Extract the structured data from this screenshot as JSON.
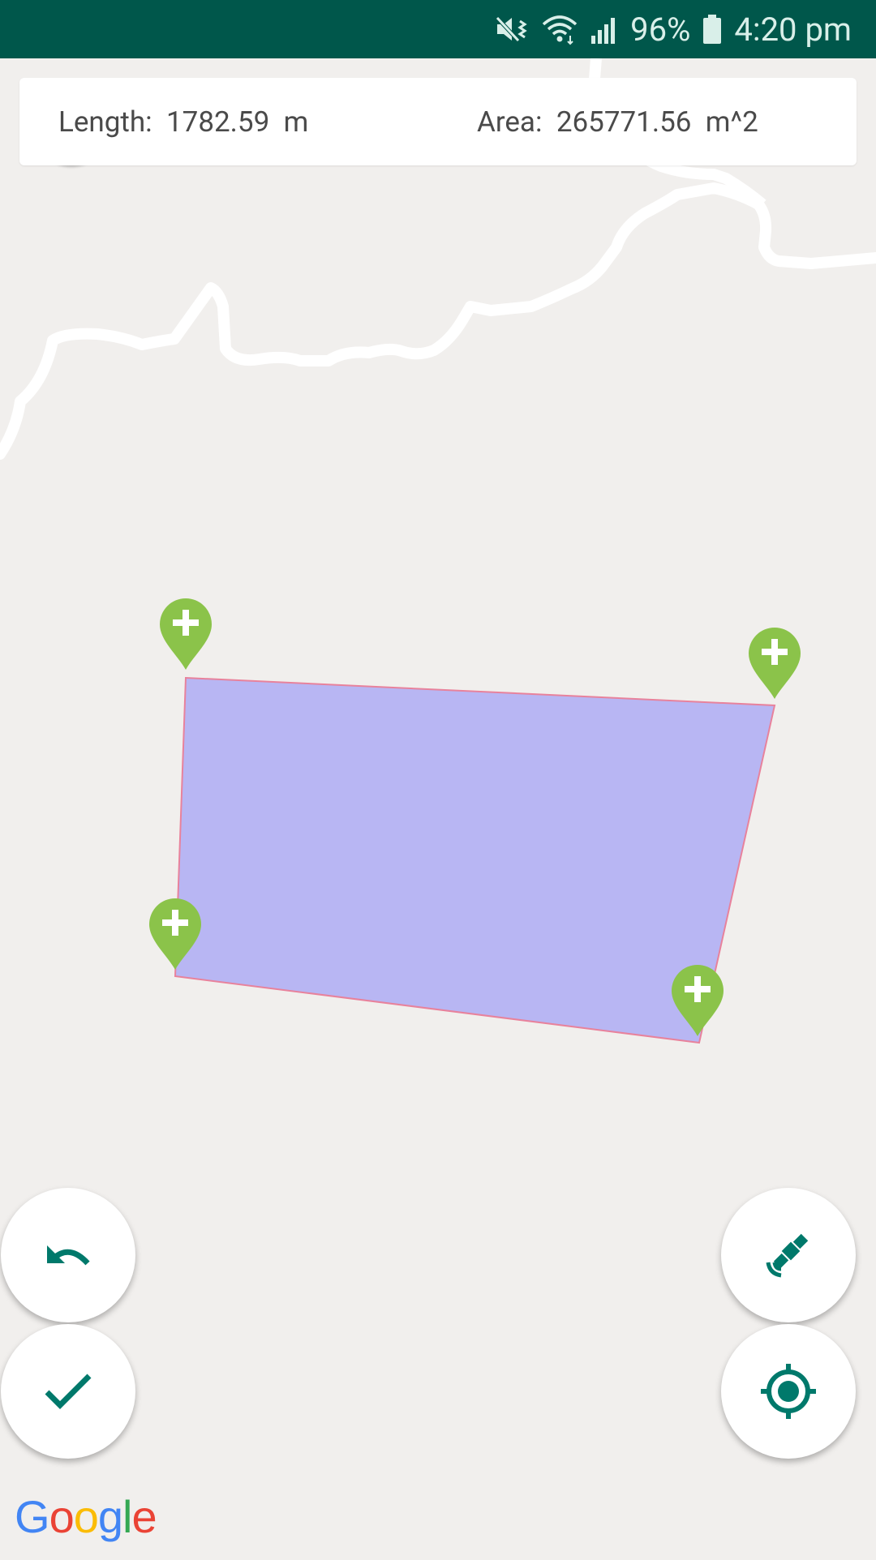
{
  "status_bar": {
    "battery_percent": "96%",
    "time": "4:20 pm",
    "icons": [
      "mute-vibrate-icon",
      "wifi-icon",
      "signal-icon",
      "battery-icon"
    ]
  },
  "info_card": {
    "length_label": "Length:",
    "length_value": "1782.59",
    "length_unit": "m",
    "area_label": "Area:",
    "area_value": "265771.56",
    "area_unit": "m^2"
  },
  "map": {
    "polygon_fill": "#b8b6f3",
    "polygon_stroke": "#e8829c",
    "marker_color": "#8bc34a",
    "markers": [
      "marker-top-left",
      "marker-top-right",
      "marker-bottom-left",
      "marker-bottom-right"
    ]
  },
  "buttons": {
    "undo": "undo-icon",
    "confirm": "check-icon",
    "satellite": "satellite-icon",
    "locate": "my-location-icon"
  },
  "attribution": {
    "text": "Google"
  },
  "colors": {
    "accent": "#00796b",
    "statusbar": "#00574b"
  }
}
